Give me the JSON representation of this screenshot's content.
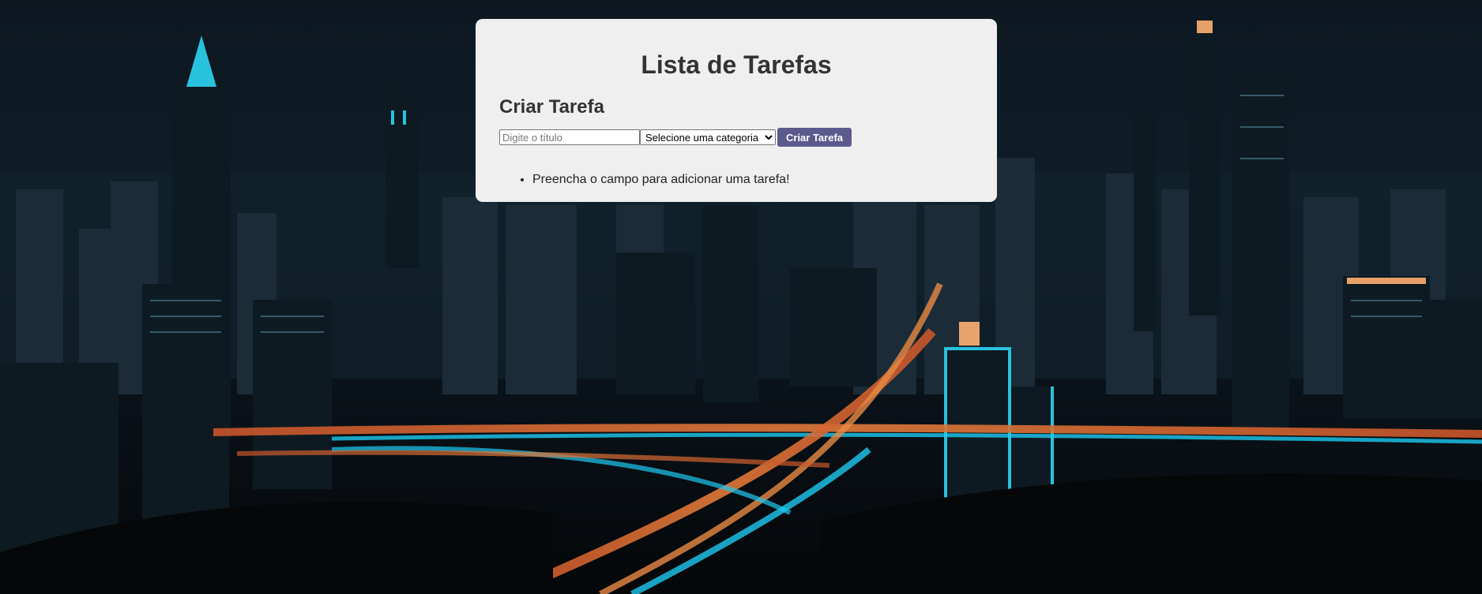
{
  "app": {
    "title": "Lista de Tarefas"
  },
  "create_section": {
    "heading": "Criar Tarefa",
    "title_input": {
      "value": "",
      "placeholder": "Digite o título"
    },
    "category_select": {
      "selected": "Selecione uma categoria"
    },
    "submit_label": "Criar Tarefa"
  },
  "task_list": {
    "items": [
      "Preencha o campo para adicionar uma tarefa!"
    ]
  },
  "colors": {
    "card_background": "#efefef",
    "button_background": "#5c5a8d",
    "button_text": "#ffffff",
    "page_background": "#0d1821"
  },
  "background": {
    "image": "night-city-skyline"
  }
}
